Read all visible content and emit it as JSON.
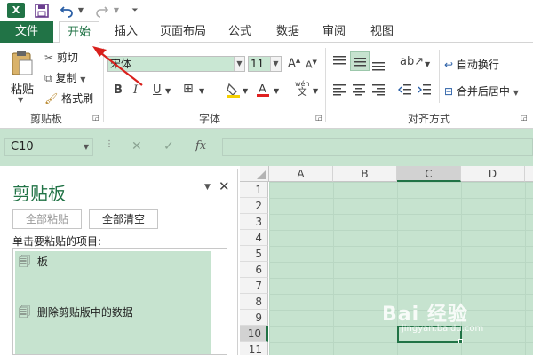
{
  "qat": {
    "logo": "X",
    "save_icon": "save-icon",
    "undo_icon": "undo-icon",
    "redo_icon": "redo-icon"
  },
  "tabs": [
    {
      "label": "文件"
    },
    {
      "label": "开始"
    },
    {
      "label": "插入"
    },
    {
      "label": "页面布局"
    },
    {
      "label": "公式"
    },
    {
      "label": "数据"
    },
    {
      "label": "审阅"
    },
    {
      "label": "视图"
    }
  ],
  "ribbon": {
    "clipboard": {
      "paste": "粘贴",
      "cut": "剪切",
      "copy": "复制",
      "format_painter": "格式刷",
      "group": "剪贴板"
    },
    "font": {
      "name": "宋体",
      "size": "11",
      "bold": "B",
      "italic": "I",
      "underline": "U",
      "phonetic": "wén",
      "group": "字体"
    },
    "alignment": {
      "wrap": "自动换行",
      "merge": "合并后居中",
      "group": "对齐方式"
    }
  },
  "formula_bar": {
    "name_box": "C10",
    "cancel": "✕",
    "enter": "✓",
    "fx": "fx"
  },
  "clipboard_pane": {
    "title": "剪贴板",
    "paste_all": "全部粘贴",
    "clear_all": "全部清空",
    "instruction": "单击要粘贴的项目:",
    "items": [
      {
        "text": "板"
      },
      {
        "text": "删除剪贴版中的数据"
      }
    ]
  },
  "grid": {
    "columns": [
      "A",
      "B",
      "C",
      "D"
    ],
    "rows": [
      "1",
      "2",
      "3",
      "4",
      "5",
      "6",
      "7",
      "8",
      "9",
      "10",
      "11"
    ],
    "active_cell": "C10"
  },
  "watermark": {
    "text": "Bai 经验",
    "sub": "jingyan.baidu.com"
  },
  "colors": {
    "accent": "#217346",
    "selection": "#c6e3cf",
    "arrow": "#d9201c"
  }
}
